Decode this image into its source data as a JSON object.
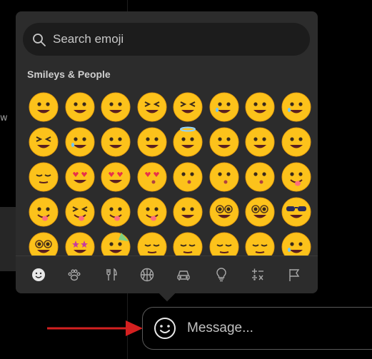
{
  "search": {
    "placeholder": "Search emoji"
  },
  "category": {
    "title": "Smileys & People"
  },
  "emojis": [
    [
      "grinning-face-big-eyes",
      "grinning-face",
      "grinning-smiling-eyes",
      "beaming-face",
      "squinting-laugh",
      "pleading-tears",
      "grinning-sweat",
      "tears-of-joy"
    ],
    [
      "rolling-on-floor",
      "face-holding-back-tears",
      "smiling-eyes",
      "smiling-face",
      "halo-face",
      "slight-smile",
      "upside-down-face",
      "winking-face"
    ],
    [
      "relieved-face",
      "heart-eyes",
      "smiling-hearts",
      "kissing-heart",
      "kissing-face",
      "kissing-face-closed",
      "kissing-smiling-eyes",
      "savoring-food"
    ],
    [
      "tongue-out",
      "squinting-tongue",
      "winking-tongue",
      "zany-face",
      "raised-eyebrow",
      "monocle-face",
      "nerd-face",
      "sunglasses-face"
    ],
    [
      "disguised-face",
      "star-struck",
      "partying-face",
      "smirking-face",
      "unamused-face",
      "disappointed-face",
      "pensive-face",
      "worried-face"
    ]
  ],
  "categories": [
    "smileys",
    "animals",
    "food",
    "activities",
    "travel",
    "objects",
    "symbols",
    "flags"
  ],
  "active_category": "smileys",
  "message": {
    "placeholder": "Message..."
  },
  "colors": {
    "accent_arrow": "#d42020",
    "picker_bg": "#2c2c2c",
    "emoji_yellow": "#fcc21b"
  }
}
